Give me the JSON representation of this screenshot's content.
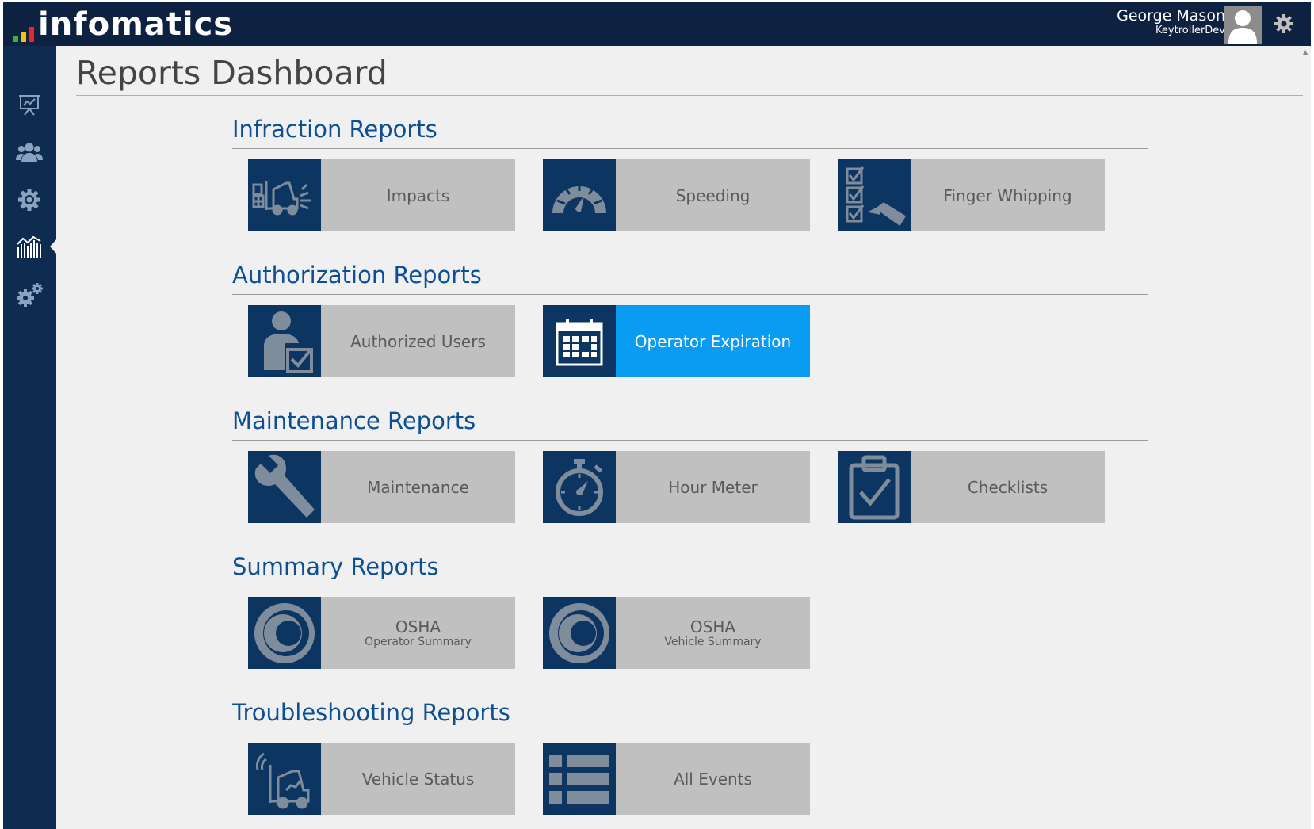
{
  "app": {
    "logo_text": "infomatics",
    "logo_bar_colors": [
      "#3cb043",
      "#f5c211",
      "#e8262a"
    ]
  },
  "user": {
    "name": "George Mason",
    "org": "KeytrollerDev"
  },
  "sidebar": {
    "items": [
      {
        "icon": "presentation-icon"
      },
      {
        "icon": "users-icon"
      },
      {
        "icon": "gear-icon"
      },
      {
        "icon": "reports-chart-icon",
        "active": true
      },
      {
        "icon": "settings-gears-icon"
      }
    ]
  },
  "page": {
    "title": "Reports Dashboard"
  },
  "sections": {
    "infraction": {
      "title": "Infraction Reports",
      "tiles": [
        {
          "label": "Impacts",
          "icon": "forklift-impact-icon"
        },
        {
          "label": "Speeding",
          "icon": "speedometer-icon"
        },
        {
          "label": "Finger Whipping",
          "icon": "checklist-pen-icon"
        }
      ]
    },
    "authorization": {
      "title": "Authorization Reports",
      "tiles": [
        {
          "label": "Authorized Users",
          "icon": "user-check-icon"
        },
        {
          "label": "Operator Expiration",
          "icon": "calendar-icon",
          "active": true
        }
      ]
    },
    "maintenance": {
      "title": "Maintenance Reports",
      "tiles": [
        {
          "label": "Maintenance",
          "icon": "wrench-icon"
        },
        {
          "label": "Hour Meter",
          "icon": "stopwatch-icon"
        },
        {
          "label": "Checklists",
          "icon": "clipboard-check-icon"
        }
      ]
    },
    "summary": {
      "title": "Summary Reports",
      "tiles": [
        {
          "label": "OSHA",
          "sublabel": "Operator Summary",
          "icon": "osha-logo-icon"
        },
        {
          "label": "OSHA",
          "sublabel": "Vehicle Summary",
          "icon": "osha-logo-icon"
        }
      ]
    },
    "troubleshooting": {
      "title": "Troubleshooting Reports",
      "tiles": [
        {
          "label": "Vehicle Status",
          "icon": "forklift-signal-icon"
        },
        {
          "label": "All Events",
          "icon": "list-icon"
        }
      ]
    }
  },
  "colors": {
    "topbar": "#0d2240",
    "sidebar": "#0d2c4f",
    "tile_icon_bg": "#0d3561",
    "tile_bg": "#c0c0c0",
    "active_tile": "#0a9cf2",
    "section_title": "#0d4f93"
  }
}
